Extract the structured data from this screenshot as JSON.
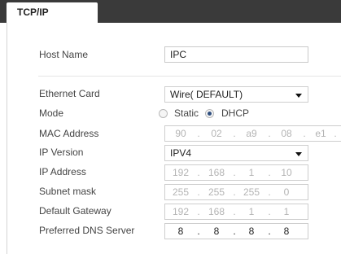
{
  "tab": {
    "label": "TCP/IP"
  },
  "host_name": {
    "label": "Host Name",
    "value": "IPC"
  },
  "ethernet_card": {
    "label": "Ethernet Card",
    "value": "Wire( DEFAULT)"
  },
  "mode": {
    "label": "Mode",
    "options": [
      "Static",
      "DHCP"
    ],
    "selected": "DHCP"
  },
  "mac_address": {
    "label": "MAC Address",
    "octets": [
      "90",
      "02",
      "a9",
      "08",
      "e1"
    ]
  },
  "ip_version": {
    "label": "IP Version",
    "value": "IPV4"
  },
  "ip_address": {
    "label": "IP Address",
    "octets": [
      "192",
      "168",
      "1",
      "10"
    ]
  },
  "subnet_mask": {
    "label": "Subnet mask",
    "octets": [
      "255",
      "255",
      "255",
      "0"
    ]
  },
  "default_gateway": {
    "label": "Default Gateway",
    "octets": [
      "192",
      "168",
      "1",
      "1"
    ]
  },
  "preferred_dns": {
    "label": "Preferred DNS Server",
    "octets": [
      "8",
      "8",
      "8",
      "8"
    ]
  },
  "separator": "."
}
